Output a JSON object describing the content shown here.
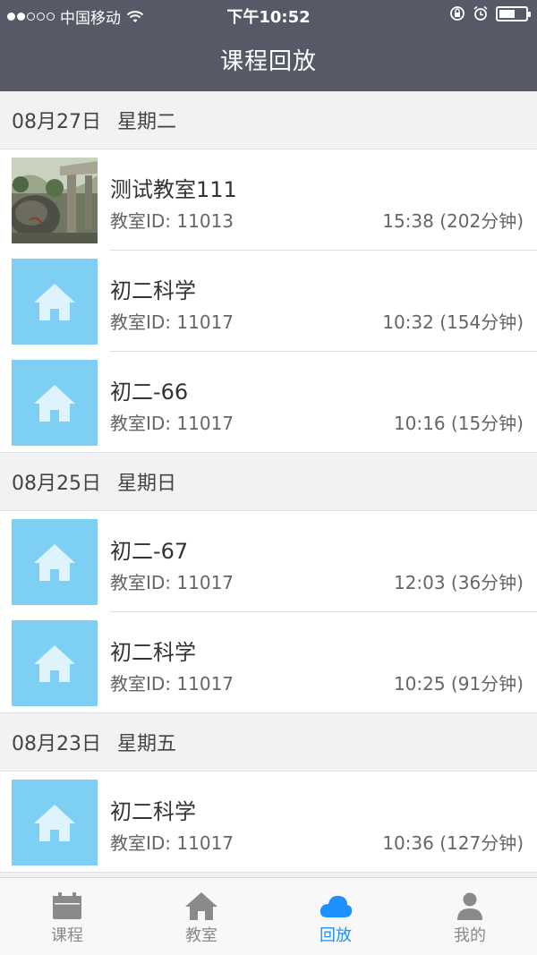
{
  "status_bar": {
    "carrier": "中国移动",
    "time": "下午10:52",
    "battery_level": 0.6,
    "icons": [
      "signal-icon",
      "wifi-icon",
      "rotation-lock-icon",
      "alarm-icon",
      "battery-icon"
    ]
  },
  "header": {
    "title": "课程回放"
  },
  "sections": [
    {
      "date": "08月27日",
      "weekday": "星期二",
      "items": [
        {
          "name": "测试教室111",
          "room": "教室ID: 11013",
          "time": "15:38 (202分钟)",
          "thumb": "photo"
        },
        {
          "name": "初二科学",
          "room": "教室ID: 11017",
          "time": "10:32 (154分钟)",
          "thumb": "house-icon"
        },
        {
          "name": "初二-66",
          "room": "教室ID: 11017",
          "time": "10:16 (15分钟)",
          "thumb": "house-icon"
        }
      ]
    },
    {
      "date": "08月25日",
      "weekday": "星期日",
      "items": [
        {
          "name": "初二-67",
          "room": "教室ID: 11017",
          "time": "12:03 (36分钟)",
          "thumb": "house-icon"
        },
        {
          "name": "初二科学",
          "room": "教室ID: 11017",
          "time": "10:25 (91分钟)",
          "thumb": "house-icon"
        }
      ]
    },
    {
      "date": "08月23日",
      "weekday": "星期五",
      "items": [
        {
          "name": "初二科学",
          "room": "教室ID: 11017",
          "time": "10:36 (127分钟)",
          "thumb": "house-icon"
        }
      ]
    }
  ],
  "tabs": [
    {
      "label": "课程",
      "icon": "calendar-icon",
      "active": false
    },
    {
      "label": "教室",
      "icon": "home-icon",
      "active": false
    },
    {
      "label": "回放",
      "icon": "cloud-icon",
      "active": true
    },
    {
      "label": "我的",
      "icon": "person-icon",
      "active": false
    }
  ],
  "colors": {
    "header_bg": "#575a66",
    "thumb_bg": "#7ecff4",
    "active_tab": "#1e90ff",
    "inactive_tab": "#8a8a8a"
  }
}
